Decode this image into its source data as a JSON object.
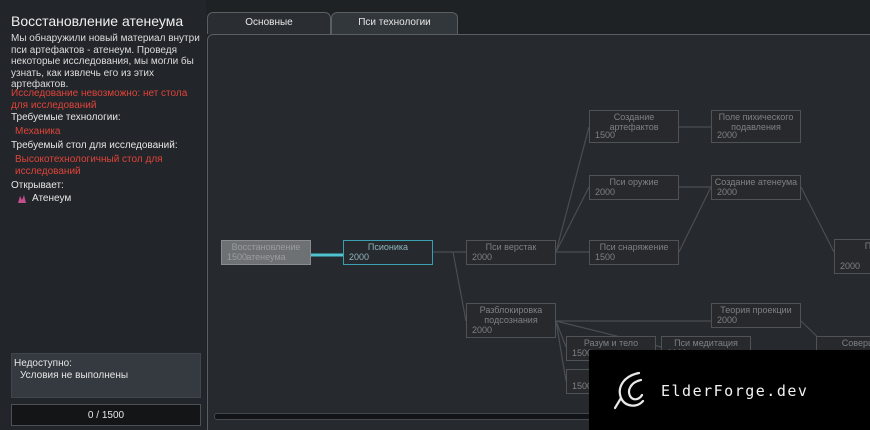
{
  "info": {
    "title": "Восстановление атенеума",
    "description": "Мы обнаружили новый материал внутри пси артефактов - атенеум. Проведя некоторые исследования, мы могли бы узнать, как извлечь его из этих артефактов.",
    "warning": "Исследование невозможно: нет стола для исследований",
    "req_tech_label": "Требуемые технологии:",
    "req_tech": "Механика",
    "req_bench_label": "Требуемый стол для исследований:",
    "req_bench": "Высокотехнологичный стол для исследований",
    "unlocks_label": "Открывает:",
    "unlocks_item": "Атенеум",
    "unlocks_icon": "ateneum-icon"
  },
  "unavailable": {
    "heading": "Недоступно:",
    "reason": "Условия не выполнены"
  },
  "progress": {
    "text": "0 / 1500",
    "current": 0,
    "total": 1500
  },
  "tabs": [
    {
      "label": "Основные",
      "active": false
    },
    {
      "label": "Пси технологии",
      "active": true
    }
  ],
  "nodes": {
    "n0": {
      "name": "Восстановление атенеума",
      "cost": "1500"
    },
    "n1": {
      "name": "Псионика",
      "cost": "2000"
    },
    "n2": {
      "name": "Пси верстак",
      "cost": "2000"
    },
    "n3": {
      "name": "Создание артефактов",
      "cost": "1500"
    },
    "n4": {
      "name": "Пси оружие",
      "cost": "2000"
    },
    "n5": {
      "name": "Пси снаряжение",
      "cost": "1500"
    },
    "n6": {
      "name": "Поле пихического подавления",
      "cost": "2000"
    },
    "n7": {
      "name": "Создание атенеума",
      "cost": "2000"
    },
    "n8": {
      "name": "Пер сн",
      "cost": "2000"
    },
    "n9": {
      "name": "Разблокировка подсознания",
      "cost": "2000"
    },
    "n10": {
      "name": "Разум и тело",
      "cost": "1500"
    },
    "n11": {
      "name": "Пси медитация",
      "cost": "2000"
    },
    "n12": {
      "name": "Теория проекции",
      "cost": "2000"
    },
    "n13": {
      "name": "Соверше",
      "cost": ""
    },
    "n14": {
      "name": "П",
      "cost": "1500"
    }
  },
  "colors": {
    "accent": "#3aa0b0",
    "warning": "#e0443a"
  },
  "watermark": {
    "text": "ElderForge.dev"
  }
}
